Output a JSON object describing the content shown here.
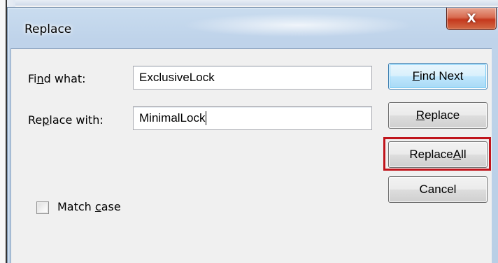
{
  "window": {
    "title": "Replace",
    "close_glyph": "X"
  },
  "fields": {
    "find_label_pre": "Fi",
    "find_label_mnemonic": "n",
    "find_label_post": "d what:",
    "find_value": "ExclusiveLock",
    "replace_label_pre": "Re",
    "replace_label_mnemonic": "p",
    "replace_label_post": "lace with:",
    "replace_value": "MinimalLock"
  },
  "buttons": {
    "find_next_mnemonic": "F",
    "find_next_rest": "ind Next",
    "replace_mnemonic": "R",
    "replace_rest": "eplace",
    "replace_all_pre": "Replace ",
    "replace_all_mnemonic": "A",
    "replace_all_post": "ll",
    "cancel_label": "Cancel"
  },
  "options": {
    "match_case_pre": "Match ",
    "match_case_mnemonic": "c",
    "match_case_post": "ase",
    "match_case_checked": false
  },
  "colors": {
    "highlight_border": "#c0151c",
    "default_button_border": "#3c7fb1",
    "close_button": "#c4381d"
  },
  "icons": {
    "close": "close-icon"
  }
}
